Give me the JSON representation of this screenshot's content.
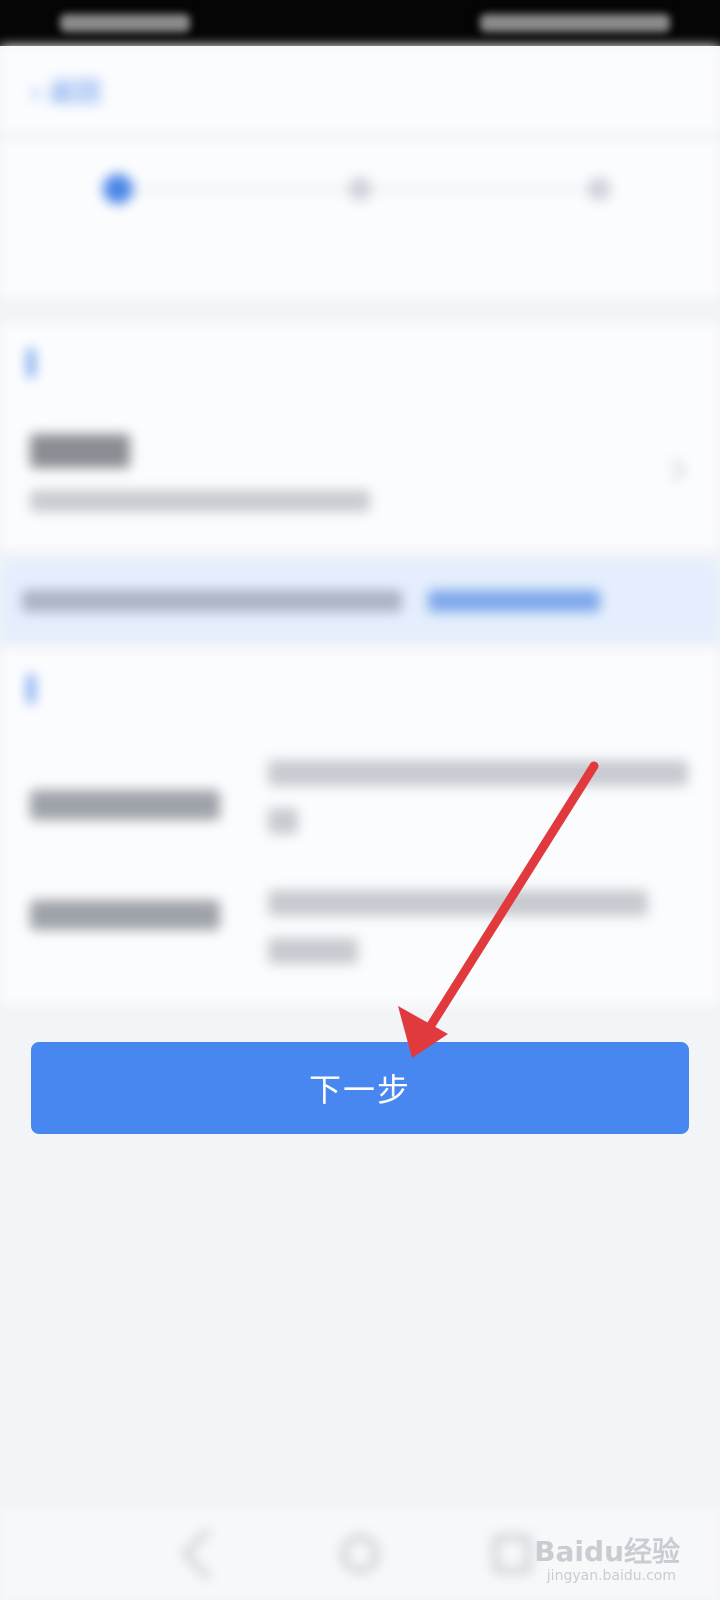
{
  "nav": {
    "back_label": "返回",
    "title": "",
    "right_label": ""
  },
  "stepper": {
    "steps": [
      {
        "label": "",
        "state": "active"
      },
      {
        "label": "",
        "state": "inactive"
      },
      {
        "label": "",
        "state": "inactive"
      }
    ]
  },
  "sections": {
    "personal": {
      "heading": ""
    },
    "info": {
      "heading": ""
    }
  },
  "next_button_label": "下一步",
  "watermark": {
    "brand": "Baidu经验",
    "site": "jingyan.baidu.com"
  },
  "colors": {
    "accent": "#4887f0",
    "arrow": "#e03a3e"
  }
}
